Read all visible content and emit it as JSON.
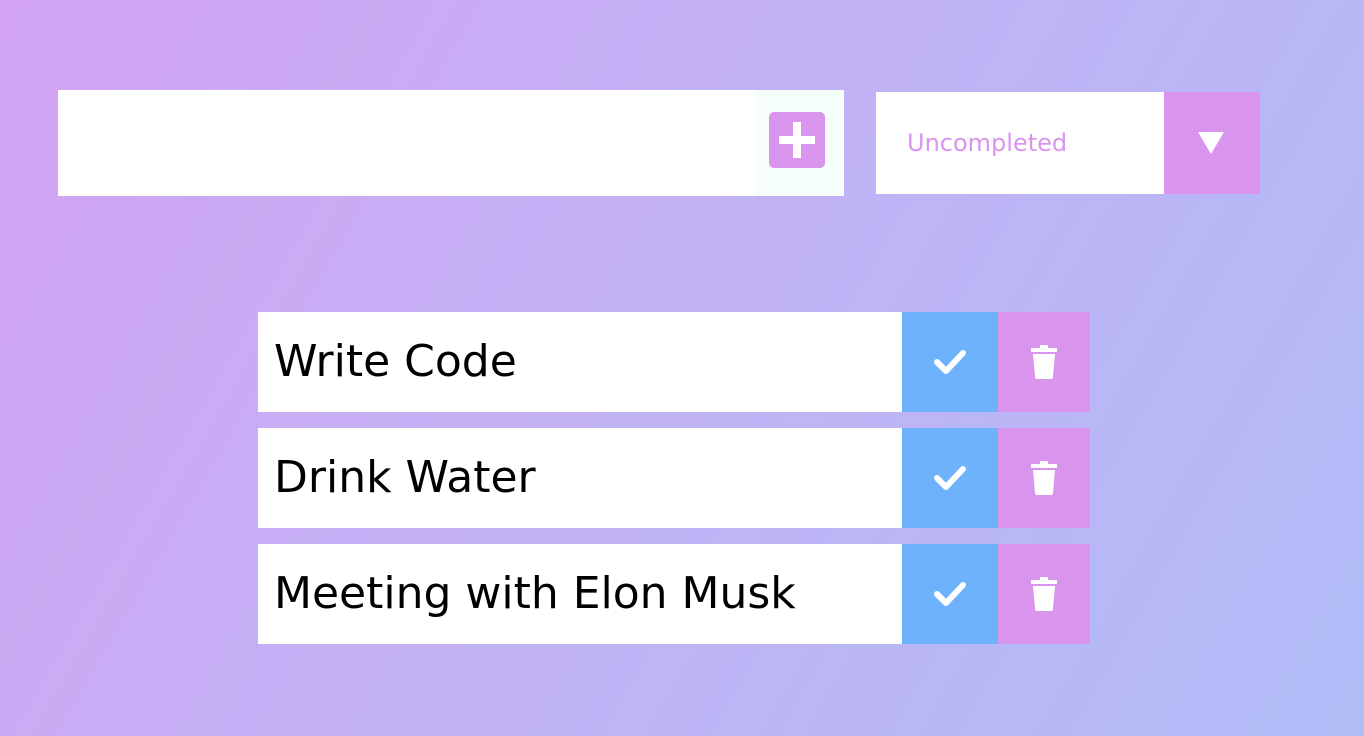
{
  "form": {
    "input_value": "",
    "input_placeholder": "",
    "add_icon": "plus-square-icon",
    "filter": {
      "selected": "Uncompleted",
      "arrow_icon": "caret-down-icon"
    }
  },
  "todos": [
    {
      "text": "Write Code",
      "complete_icon": "check-icon",
      "delete_icon": "trash-icon"
    },
    {
      "text": "Drink Water",
      "complete_icon": "check-icon",
      "delete_icon": "trash-icon"
    },
    {
      "text": "Meeting with Elon Musk",
      "complete_icon": "check-icon",
      "delete_icon": "trash-icon"
    }
  ],
  "colors": {
    "accent": "#d994ee",
    "complete": "#6fb2fc",
    "background_start": "#d3a3f4",
    "background_end": "#b1bcf7"
  }
}
